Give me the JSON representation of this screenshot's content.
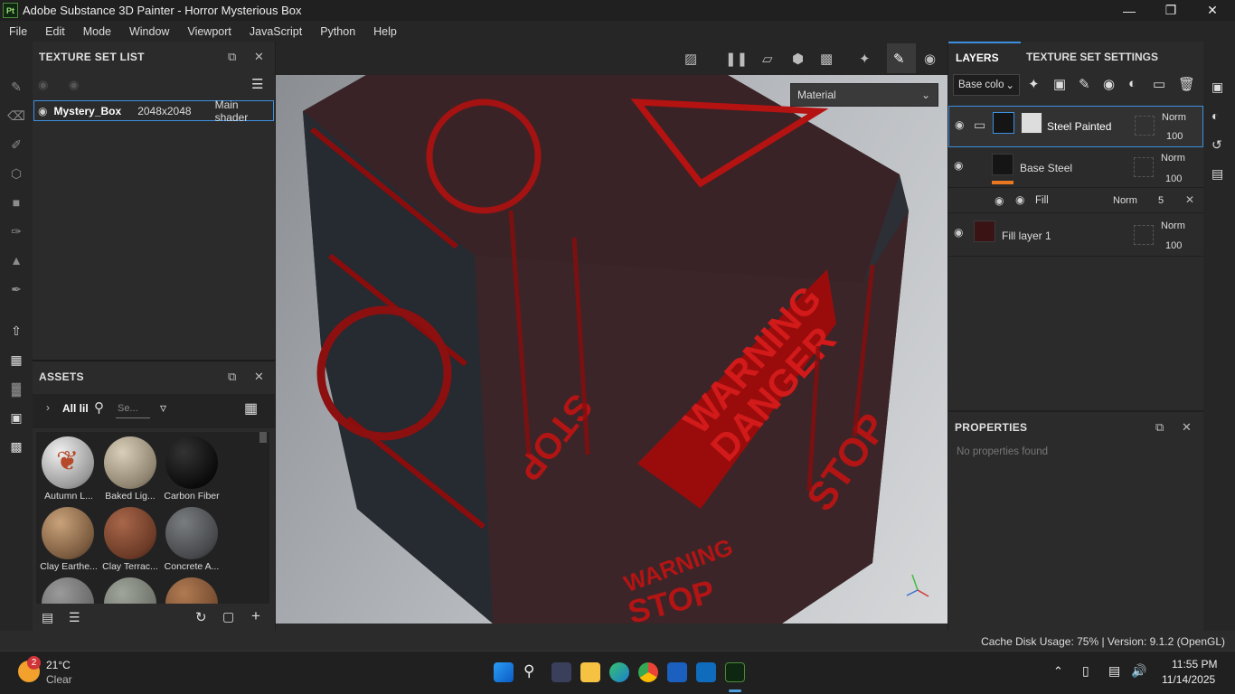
{
  "window": {
    "logo": "Pt",
    "title": "Adobe Substance 3D Painter - Horror Mysterious Box",
    "controls": [
      "minimize-icon",
      "maximize-icon",
      "close-icon"
    ]
  },
  "menu": [
    "File",
    "Edit",
    "Mode",
    "Window",
    "Viewport",
    "JavaScript",
    "Python",
    "Help"
  ],
  "texture_set_list": {
    "title": "TEXTURE SET LIST",
    "row": {
      "name": "Mystery_Box",
      "resolution": "2048x2048",
      "shader": "Main shader"
    }
  },
  "assets": {
    "title": "ASSETS",
    "filter_label": "All lil",
    "search_placeholder": "Se...",
    "items": [
      {
        "label": "Autumn L...",
        "color": "#c8c8c8"
      },
      {
        "label": "Baked Lig...",
        "color": "#a89d86"
      },
      {
        "label": "Carbon Fiber",
        "color": "#0e0e0e"
      },
      {
        "label": "Clay Earthe...",
        "color": "#8a6a4c"
      },
      {
        "label": "Clay Terrac...",
        "color": "#6b3a26"
      },
      {
        "label": "Concrete A...",
        "color": "#4d4f52"
      }
    ]
  },
  "viewport": {
    "material_dropdown": "Material",
    "labels": [
      "WARNING",
      "DANGER",
      "STOP",
      "STOP",
      "WARNING",
      "STOP"
    ],
    "accent": "#b01010"
  },
  "layers": {
    "tab_layers": "LAYERS",
    "tab_texture_settings": "TEXTURE SET SETTINGS",
    "channel_dropdown": "Base colo",
    "rows": [
      {
        "name": "Steel Painted",
        "blend": "Norm",
        "opacity": "100"
      },
      {
        "name": "Base Steel",
        "blend": "Norm",
        "opacity": "100"
      },
      {
        "name": "Fill",
        "blend": "Norm",
        "opacity": "5"
      },
      {
        "name": "Fill layer 1",
        "blend": "Norm",
        "opacity": "100"
      }
    ]
  },
  "properties": {
    "title": "PROPERTIES",
    "empty": "No properties found"
  },
  "status": {
    "text": "Cache Disk Usage:   75% | Version: 9.1.2 (OpenGL)"
  },
  "taskbar": {
    "weather_badge": "2",
    "temperature": "21°C",
    "condition": "Clear",
    "time": "11:55 PM",
    "date": "11/14/2025"
  }
}
